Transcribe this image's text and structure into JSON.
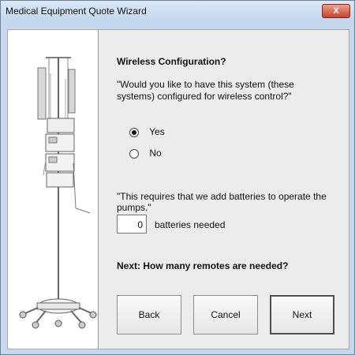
{
  "window": {
    "title": "Medical Equipment Quote Wizard",
    "close_glyph": "X"
  },
  "image": {
    "name": "iv-stand-pumps-image"
  },
  "wireless": {
    "heading": "Wireless Configuration?",
    "question": "\"Would you like to have this system (these systems) configured for wireless control?\"",
    "options": [
      {
        "label": "Yes",
        "selected": true
      },
      {
        "label": "No",
        "selected": false
      }
    ]
  },
  "batteries": {
    "note": "\"This requires that we add batteries to operate the pumps.\"",
    "value": "0",
    "label": "batteries needed"
  },
  "next_prompt": "Next: How many remotes are needed?",
  "buttons": {
    "back": "Back",
    "cancel": "Cancel",
    "next": "Next"
  }
}
